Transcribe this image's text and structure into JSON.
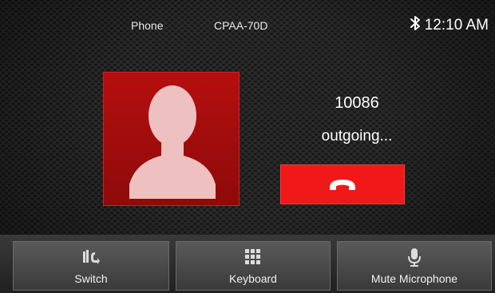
{
  "topbar": {
    "app_name": "Phone",
    "device_name": "CPAA-70D",
    "time": "12:10 AM",
    "bluetooth_icon": "bluetooth-icon"
  },
  "call": {
    "number": "10086",
    "status": "outgoing...",
    "avatar_icon": "contact-silhouette-icon",
    "hangup_icon": "hang-up-icon"
  },
  "buttons": {
    "switch_label": "Switch",
    "keyboard_label": "Keyboard",
    "mute_label": "Mute Microphone"
  },
  "colors": {
    "accent_red": "#f01818",
    "avatar_red": "#a80d0d",
    "background": "#141414"
  }
}
